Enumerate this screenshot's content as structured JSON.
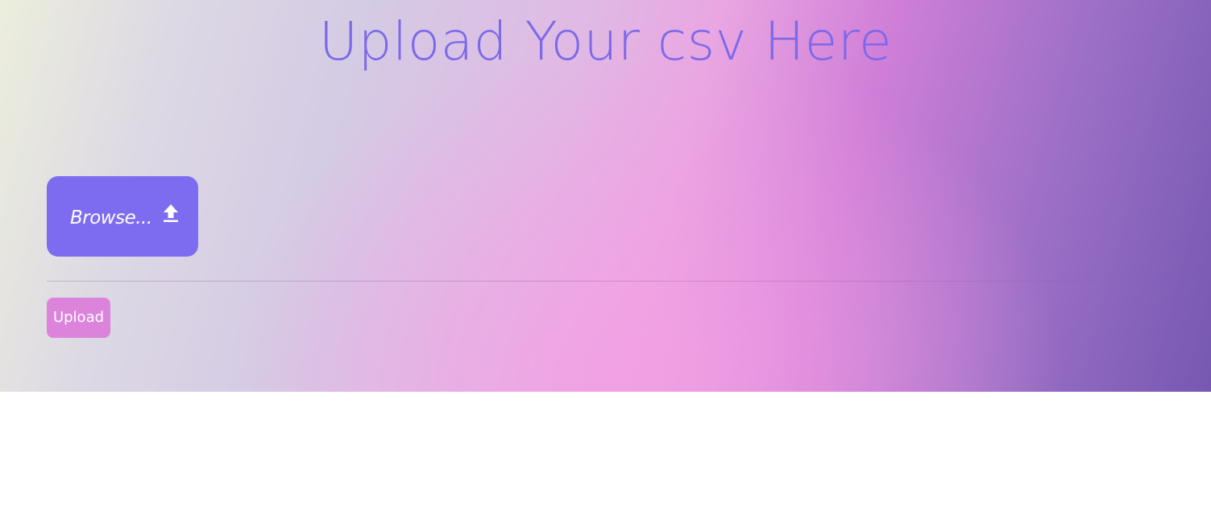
{
  "page": {
    "title": "Upload Your csv Here"
  },
  "file_picker": {
    "browse_label": "Browse...",
    "icon": "upload-arrow-icon"
  },
  "actions": {
    "upload_label": "Upload"
  },
  "colors": {
    "title": "#7c69ea",
    "browse_button": "#7e6cf0",
    "upload_button": "#dc84dc",
    "gradient_start": "#eceedd",
    "gradient_mid": "#f0a0e2",
    "gradient_end": "#7658b2"
  }
}
